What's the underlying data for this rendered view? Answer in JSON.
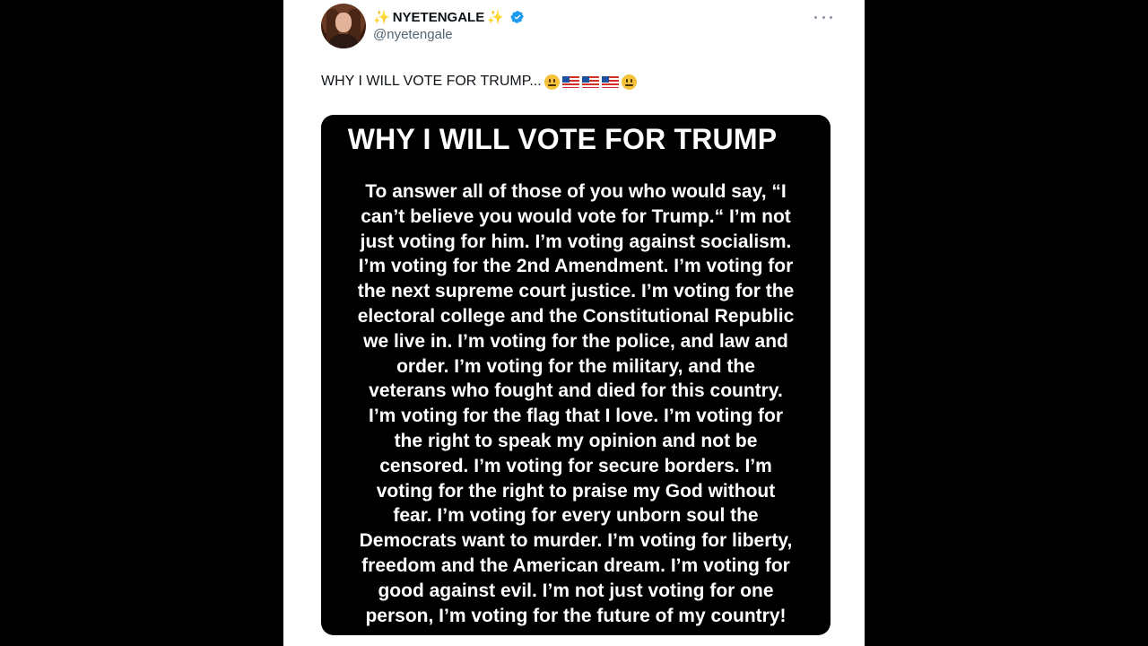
{
  "tweet": {
    "author": {
      "display_name": "NYETENGALE",
      "sparkle_left": "✨",
      "sparkle_right": "✨",
      "handle": "@nyetengale",
      "verified": true
    },
    "text": "WHY I WILL VOTE FOR TRUMP...",
    "emojis": [
      "face-with-raised-eyebrow",
      "us-flag",
      "us-flag",
      "us-flag",
      "face-with-raised-eyebrow"
    ],
    "media": {
      "title": "WHY I WILL VOTE FOR TRUMP",
      "lines": [
        "To answer all of those of you who would say, “I",
        "can’t believe you would vote for Trump.“ I’m not",
        "just voting for him. I’m voting against socialism.",
        "I’m voting for the 2nd Amendment. I’m voting for",
        "the next supreme court justice. I’m voting for the",
        "electoral college and the Constitutional Republic",
        "we live in. I’m voting for the police, and law and",
        "order. I’m voting for the military, and the",
        "veterans who fought and died for this country.",
        "I’m voting for the flag that I love. I’m voting for",
        "the right to speak my opinion and not be",
        "censored. I’m voting for secure borders. I’m",
        "voting for the right to praise my God without",
        "fear. I’m voting for every unborn soul the",
        "Democrats want to murder. I’m voting for liberty,",
        "freedom and the American dream. I’m voting for",
        "good against evil. I’m not just voting for one",
        "person, I’m voting for the future of my country!"
      ]
    }
  },
  "colors": {
    "background": "#000000",
    "card": "#ffffff",
    "verified": "#1d9bf0",
    "handle": "#536471",
    "text": "#0f1419"
  }
}
